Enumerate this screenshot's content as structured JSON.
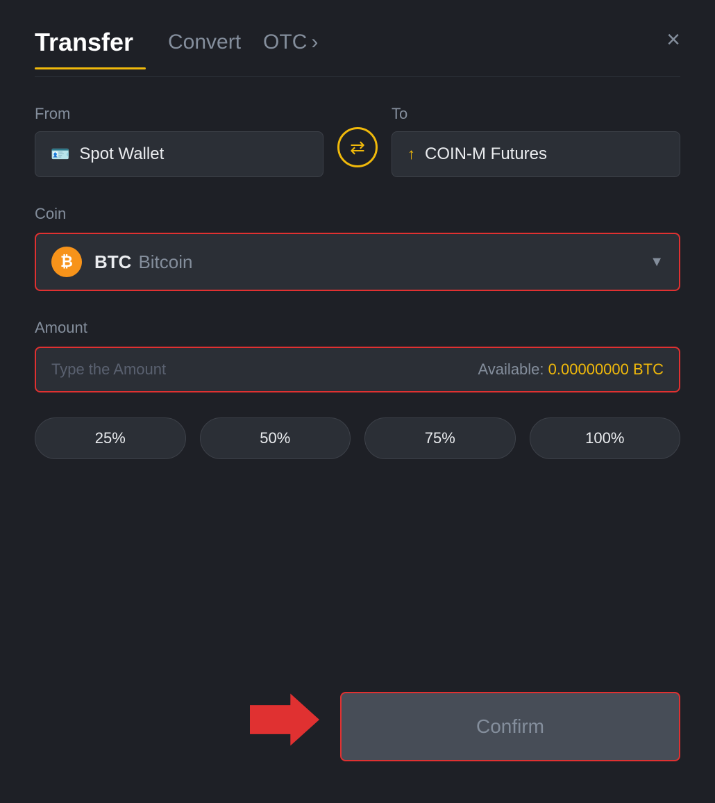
{
  "header": {
    "transfer_label": "Transfer",
    "convert_label": "Convert",
    "otc_label": "OTC",
    "close_icon": "×"
  },
  "from": {
    "label": "From",
    "wallet_label": "Spot Wallet"
  },
  "to": {
    "label": "To",
    "wallet_label": "COIN-M Futures"
  },
  "coin": {
    "label": "Coin",
    "symbol": "BTC",
    "name": "Bitcoin"
  },
  "amount": {
    "label": "Amount",
    "placeholder": "Type the Amount",
    "available_label": "Available:",
    "available_value": "0.00000000 BTC"
  },
  "percentages": [
    "25%",
    "50%",
    "75%",
    "100%"
  ],
  "confirm_button": "Confirm"
}
